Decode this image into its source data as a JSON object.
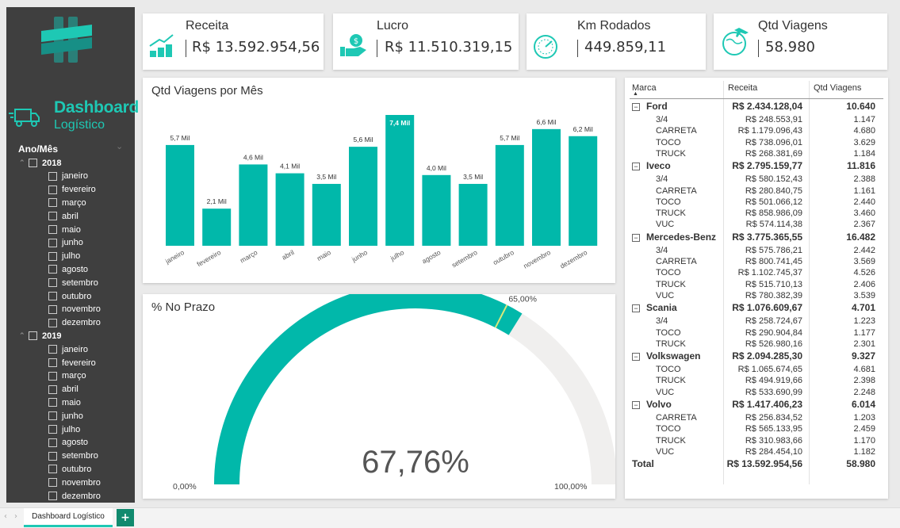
{
  "kpis": {
    "receita": {
      "label": "Receita",
      "value": "R$ 13.592.954,56",
      "icon": "money-growth-icon"
    },
    "lucro": {
      "label": "Lucro",
      "value": "R$ 11.510.319,15",
      "icon": "money-hand-icon"
    },
    "km": {
      "label": "Km Rodados",
      "value": "449.859,11",
      "icon": "speedometer-icon"
    },
    "viagens": {
      "label": "Qtd Viagens",
      "value": "58.980",
      "icon": "globe-plane-icon"
    }
  },
  "sidebar": {
    "title": "Dashboard",
    "subtitle": "Logístico",
    "slicer_title": "Ano/Mês",
    "years": [
      {
        "label": "2018",
        "months": [
          "janeiro",
          "fevereiro",
          "março",
          "abril",
          "maio",
          "junho",
          "julho",
          "agosto",
          "setembro",
          "outubro",
          "novembro",
          "dezembro"
        ]
      },
      {
        "label": "2019",
        "months": [
          "janeiro",
          "fevereiro",
          "março",
          "abril",
          "maio",
          "junho",
          "julho",
          "agosto",
          "setembro",
          "outubro",
          "novembro",
          "dezembro"
        ]
      }
    ]
  },
  "bar_title": "Qtd Viagens por Mês",
  "gauge_title": "% No Prazo",
  "chart_data": [
    {
      "type": "bar",
      "title": "Qtd Viagens por Mês",
      "categories": [
        "janeiro",
        "fevereiro",
        "março",
        "abril",
        "maio",
        "junho",
        "julho",
        "agosto",
        "setembro",
        "outubro",
        "novembro",
        "dezembro"
      ],
      "values": [
        5.7,
        2.1,
        4.6,
        4.1,
        3.5,
        5.6,
        7.4,
        4.0,
        3.5,
        5.7,
        6.6,
        6.2
      ],
      "data_labels": [
        "5,7 Mil",
        "2,1 Mil",
        "4,6 Mil",
        "4,1 Mil",
        "3,5 Mil",
        "5,6 Mil",
        "7,4 Mil",
        "4,0 Mil",
        "3,5 Mil",
        "5,7 Mil",
        "6,6 Mil",
        "6,2 Mil"
      ],
      "color": "#01b8aa",
      "ylim": [
        0,
        8
      ]
    },
    {
      "type": "gauge",
      "title": "% No Prazo",
      "value": 67.76,
      "value_label": "67,76%",
      "target": 65.0,
      "target_label": "65,00%",
      "min_label": "0,00%",
      "max_label": "100,00%",
      "range": [
        0,
        100
      ],
      "color": "#01b8aa",
      "track_color": "#f0efee",
      "target_color": "#d9e87a"
    }
  ],
  "table": {
    "headers": [
      "Marca",
      "Receita",
      "Qtd Viagens"
    ],
    "rows": [
      {
        "kind": "brand",
        "name": "Ford",
        "receita": "R$ 2.434.128,04",
        "qtd": "10.640"
      },
      {
        "kind": "sub",
        "name": "3/4",
        "receita": "R$ 248.553,91",
        "qtd": "1.147"
      },
      {
        "kind": "sub",
        "name": "CARRETA",
        "receita": "R$ 1.179.096,43",
        "qtd": "4.680"
      },
      {
        "kind": "sub",
        "name": "TOCO",
        "receita": "R$ 738.096,01",
        "qtd": "3.629"
      },
      {
        "kind": "sub",
        "name": "TRUCK",
        "receita": "R$ 268.381,69",
        "qtd": "1.184"
      },
      {
        "kind": "brand",
        "name": "Iveco",
        "receita": "R$ 2.795.159,77",
        "qtd": "11.816"
      },
      {
        "kind": "sub",
        "name": "3/4",
        "receita": "R$ 580.152,43",
        "qtd": "2.388"
      },
      {
        "kind": "sub",
        "name": "CARRETA",
        "receita": "R$ 280.840,75",
        "qtd": "1.161"
      },
      {
        "kind": "sub",
        "name": "TOCO",
        "receita": "R$ 501.066,12",
        "qtd": "2.440"
      },
      {
        "kind": "sub",
        "name": "TRUCK",
        "receita": "R$ 858.986,09",
        "qtd": "3.460"
      },
      {
        "kind": "sub",
        "name": "VUC",
        "receita": "R$ 574.114,38",
        "qtd": "2.367"
      },
      {
        "kind": "brand",
        "name": "Mercedes-Benz",
        "receita": "R$ 3.775.365,55",
        "qtd": "16.482"
      },
      {
        "kind": "sub",
        "name": "3/4",
        "receita": "R$ 575.786,21",
        "qtd": "2.442"
      },
      {
        "kind": "sub",
        "name": "CARRETA",
        "receita": "R$ 800.741,45",
        "qtd": "3.569"
      },
      {
        "kind": "sub",
        "name": "TOCO",
        "receita": "R$ 1.102.745,37",
        "qtd": "4.526"
      },
      {
        "kind": "sub",
        "name": "TRUCK",
        "receita": "R$ 515.710,13",
        "qtd": "2.406"
      },
      {
        "kind": "sub",
        "name": "VUC",
        "receita": "R$ 780.382,39",
        "qtd": "3.539"
      },
      {
        "kind": "brand",
        "name": "Scania",
        "receita": "R$ 1.076.609,67",
        "qtd": "4.701"
      },
      {
        "kind": "sub",
        "name": "3/4",
        "receita": "R$ 258.724,67",
        "qtd": "1.223"
      },
      {
        "kind": "sub",
        "name": "TOCO",
        "receita": "R$ 290.904,84",
        "qtd": "1.177"
      },
      {
        "kind": "sub",
        "name": "TRUCK",
        "receita": "R$ 526.980,16",
        "qtd": "2.301"
      },
      {
        "kind": "brand",
        "name": "Volkswagen",
        "receita": "R$ 2.094.285,30",
        "qtd": "9.327"
      },
      {
        "kind": "sub",
        "name": "TOCO",
        "receita": "R$ 1.065.674,65",
        "qtd": "4.681"
      },
      {
        "kind": "sub",
        "name": "TRUCK",
        "receita": "R$ 494.919,66",
        "qtd": "2.398"
      },
      {
        "kind": "sub",
        "name": "VUC",
        "receita": "R$ 533.690,99",
        "qtd": "2.248"
      },
      {
        "kind": "brand",
        "name": "Volvo",
        "receita": "R$ 1.417.406,23",
        "qtd": "6.014"
      },
      {
        "kind": "sub",
        "name": "CARRETA",
        "receita": "R$ 256.834,52",
        "qtd": "1.203"
      },
      {
        "kind": "sub",
        "name": "TOCO",
        "receita": "R$ 565.133,95",
        "qtd": "2.459"
      },
      {
        "kind": "sub",
        "name": "TRUCK",
        "receita": "R$ 310.983,66",
        "qtd": "1.170"
      },
      {
        "kind": "sub",
        "name": "VUC",
        "receita": "R$ 284.454,10",
        "qtd": "1.182"
      },
      {
        "kind": "total",
        "name": "Total",
        "receita": "R$ 13.592.954,56",
        "qtd": "58.980"
      }
    ]
  },
  "tabs": {
    "active": "Dashboard Logístico",
    "add_label": "+"
  },
  "colors": {
    "accent": "#01b8aa",
    "sidebar_bg": "#3f3f3f",
    "title_teal": "#1ec8b4"
  }
}
